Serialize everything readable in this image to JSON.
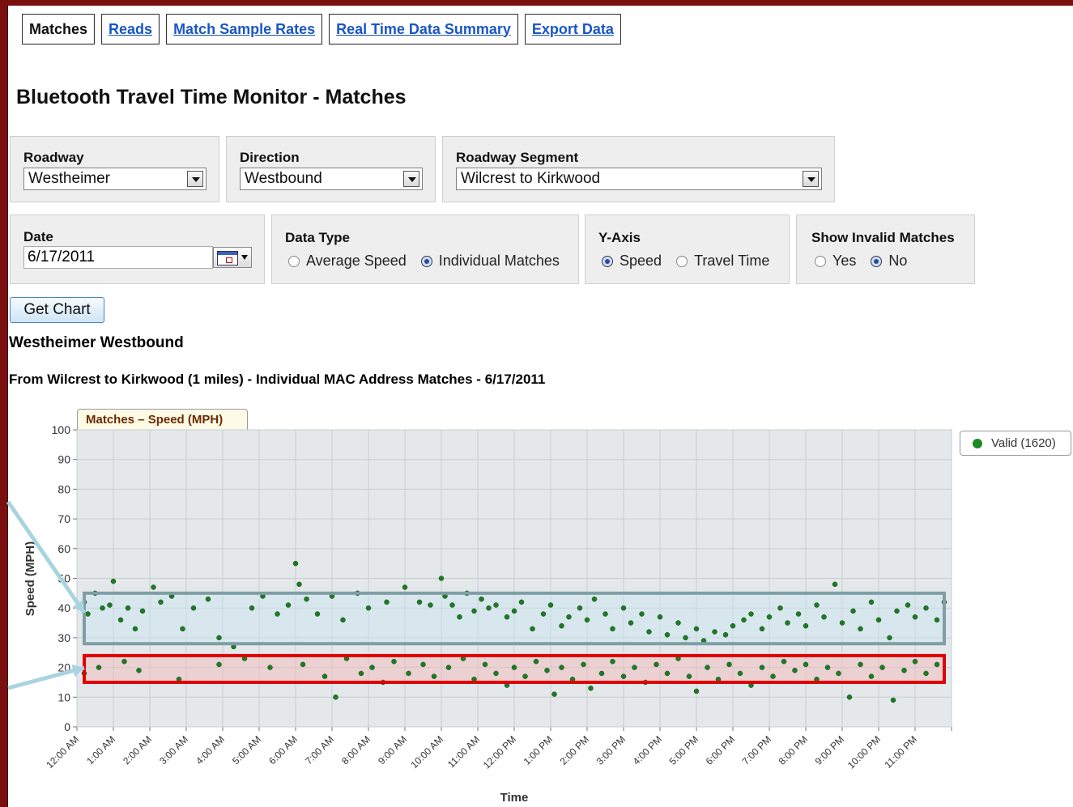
{
  "nav": {
    "tabs": [
      {
        "label": "Matches",
        "active": true
      },
      {
        "label": "Reads",
        "active": false
      },
      {
        "label": "Match Sample Rates",
        "active": false
      },
      {
        "label": "Real Time Data Summary",
        "active": false
      },
      {
        "label": "Export Data",
        "active": false
      }
    ]
  },
  "page": {
    "title": "Bluetooth Travel Time Monitor - Matches"
  },
  "filters": {
    "roadway": {
      "label": "Roadway",
      "value": "Westheimer"
    },
    "direction": {
      "label": "Direction",
      "value": "Westbound"
    },
    "segment": {
      "label": "Roadway Segment",
      "value": "Wilcrest to Kirkwood"
    },
    "date": {
      "label": "Date",
      "value": "6/17/2011"
    },
    "data_type": {
      "label": "Data Type",
      "options": [
        "Average Speed",
        "Individual Matches"
      ],
      "selected": "Individual Matches"
    },
    "y_axis": {
      "label": "Y-Axis",
      "options": [
        "Speed",
        "Travel Time"
      ],
      "selected": "Speed"
    },
    "show_invalid": {
      "label": "Show Invalid Matches",
      "options": [
        "Yes",
        "No"
      ],
      "selected": "No"
    }
  },
  "actions": {
    "get_chart": "Get Chart"
  },
  "report": {
    "heading": "Westheimer Westbound",
    "subheading": "From Wilcrest to Kirkwood (1 miles) - Individual MAC Address Matches - 6/17/2011"
  },
  "chart_data": {
    "type": "scatter",
    "tab_label": "Matches – Speed (MPH)",
    "xlabel": "Time",
    "ylabel": "Speed (MPH)",
    "ylim": [
      0,
      100
    ],
    "y_ticks": [
      0,
      10,
      20,
      30,
      40,
      50,
      60,
      70,
      80,
      90,
      100
    ],
    "x_ticks": [
      "12:00 AM",
      "1:00 AM",
      "2:00 AM",
      "3:00 AM",
      "4:00 AM",
      "5:00 AM",
      "6:00 AM",
      "7:00 AM",
      "8:00 AM",
      "9:00 AM",
      "10:00 AM",
      "11:00 AM",
      "12:00 PM",
      "1:00 PM",
      "2:00 PM",
      "3:00 PM",
      "4:00 PM",
      "5:00 PM",
      "6:00 PM",
      "7:00 PM",
      "8:00 PM",
      "9:00 PM",
      "10:00 PM",
      "11:00 PM"
    ],
    "grid": true,
    "legend": "right",
    "series": [
      {
        "name": "Valid (1620)",
        "color": "#1e7a25",
        "point_count": 1620,
        "x_unit": "hours",
        "points": [
          [
            0.2,
            42
          ],
          [
            0.3,
            38
          ],
          [
            0.5,
            45
          ],
          [
            0.7,
            40
          ],
          [
            0.9,
            41
          ],
          [
            1.0,
            49
          ],
          [
            1.2,
            36
          ],
          [
            1.4,
            40
          ],
          [
            1.6,
            33
          ],
          [
            1.8,
            39
          ],
          [
            2.1,
            47
          ],
          [
            2.3,
            42
          ],
          [
            2.6,
            44
          ],
          [
            2.9,
            33
          ],
          [
            3.2,
            40
          ],
          [
            3.6,
            43
          ],
          [
            3.9,
            30
          ],
          [
            4.3,
            27
          ],
          [
            4.8,
            40
          ],
          [
            5.1,
            44
          ],
          [
            5.5,
            38
          ],
          [
            5.8,
            41
          ],
          [
            6.0,
            55
          ],
          [
            6.1,
            48
          ],
          [
            6.3,
            43
          ],
          [
            6.6,
            38
          ],
          [
            7.0,
            44
          ],
          [
            7.3,
            36
          ],
          [
            7.7,
            45
          ],
          [
            8.0,
            40
          ],
          [
            8.5,
            42
          ],
          [
            9.0,
            47
          ],
          [
            9.4,
            42
          ],
          [
            9.7,
            41
          ],
          [
            10.0,
            50
          ],
          [
            10.1,
            44
          ],
          [
            10.3,
            41
          ],
          [
            10.5,
            37
          ],
          [
            10.7,
            45
          ],
          [
            10.9,
            39
          ],
          [
            11.1,
            43
          ],
          [
            11.3,
            40
          ],
          [
            11.5,
            41
          ],
          [
            11.8,
            37
          ],
          [
            12.0,
            39
          ],
          [
            12.2,
            42
          ],
          [
            12.5,
            33
          ],
          [
            12.8,
            38
          ],
          [
            13.0,
            41
          ],
          [
            13.3,
            34
          ],
          [
            13.5,
            37
          ],
          [
            13.8,
            40
          ],
          [
            14.0,
            36
          ],
          [
            14.2,
            43
          ],
          [
            14.5,
            38
          ],
          [
            14.7,
            33
          ],
          [
            15.0,
            40
          ],
          [
            15.2,
            35
          ],
          [
            15.5,
            38
          ],
          [
            15.7,
            32
          ],
          [
            16.0,
            37
          ],
          [
            16.2,
            31
          ],
          [
            16.5,
            35
          ],
          [
            16.7,
            30
          ],
          [
            17.0,
            33
          ],
          [
            17.2,
            29
          ],
          [
            17.5,
            32
          ],
          [
            17.8,
            31
          ],
          [
            18.0,
            34
          ],
          [
            18.3,
            36
          ],
          [
            18.5,
            38
          ],
          [
            18.8,
            33
          ],
          [
            19.0,
            37
          ],
          [
            19.3,
            40
          ],
          [
            19.5,
            35
          ],
          [
            19.8,
            38
          ],
          [
            20.0,
            34
          ],
          [
            20.3,
            41
          ],
          [
            20.5,
            37
          ],
          [
            20.8,
            48
          ],
          [
            21.0,
            35
          ],
          [
            21.3,
            39
          ],
          [
            21.5,
            33
          ],
          [
            21.8,
            42
          ],
          [
            22.0,
            36
          ],
          [
            22.3,
            30
          ],
          [
            22.5,
            39
          ],
          [
            22.8,
            41
          ],
          [
            23.0,
            37
          ],
          [
            23.3,
            40
          ],
          [
            23.6,
            36
          ],
          [
            23.8,
            42
          ],
          [
            0.2,
            18
          ],
          [
            0.6,
            20
          ],
          [
            1.3,
            22
          ],
          [
            1.7,
            19
          ],
          [
            2.8,
            16
          ],
          [
            3.9,
            21
          ],
          [
            4.6,
            23
          ],
          [
            5.3,
            20
          ],
          [
            6.2,
            21
          ],
          [
            6.8,
            17
          ],
          [
            7.1,
            10
          ],
          [
            7.4,
            23
          ],
          [
            7.8,
            18
          ],
          [
            8.1,
            20
          ],
          [
            8.4,
            15
          ],
          [
            8.7,
            22
          ],
          [
            9.1,
            18
          ],
          [
            9.5,
            21
          ],
          [
            9.8,
            17
          ],
          [
            10.2,
            20
          ],
          [
            10.6,
            23
          ],
          [
            10.9,
            16
          ],
          [
            11.2,
            21
          ],
          [
            11.5,
            18
          ],
          [
            11.8,
            14
          ],
          [
            12.0,
            20
          ],
          [
            12.3,
            17
          ],
          [
            12.6,
            22
          ],
          [
            12.9,
            19
          ],
          [
            13.1,
            11
          ],
          [
            13.3,
            20
          ],
          [
            13.6,
            16
          ],
          [
            13.9,
            21
          ],
          [
            14.1,
            13
          ],
          [
            14.4,
            18
          ],
          [
            14.7,
            22
          ],
          [
            15.0,
            17
          ],
          [
            15.3,
            20
          ],
          [
            15.6,
            15
          ],
          [
            15.9,
            21
          ],
          [
            16.2,
            18
          ],
          [
            16.5,
            23
          ],
          [
            16.8,
            17
          ],
          [
            17.0,
            12
          ],
          [
            17.3,
            20
          ],
          [
            17.6,
            16
          ],
          [
            17.9,
            21
          ],
          [
            18.2,
            18
          ],
          [
            18.5,
            14
          ],
          [
            18.8,
            20
          ],
          [
            19.1,
            17
          ],
          [
            19.4,
            22
          ],
          [
            19.7,
            19
          ],
          [
            20.0,
            21
          ],
          [
            20.3,
            16
          ],
          [
            20.6,
            20
          ],
          [
            20.9,
            18
          ],
          [
            21.2,
            10
          ],
          [
            21.5,
            21
          ],
          [
            21.8,
            17
          ],
          [
            22.1,
            20
          ],
          [
            22.4,
            9
          ],
          [
            22.7,
            19
          ],
          [
            23.0,
            22
          ],
          [
            23.3,
            18
          ],
          [
            23.6,
            21
          ]
        ]
      }
    ],
    "annotations": [
      {
        "type": "highlight-box",
        "color": "#7f9ea6",
        "y_range": [
          28,
          45
        ],
        "x_range": [
          0.2,
          23.8
        ]
      },
      {
        "type": "highlight-box",
        "color": "#e00000",
        "y_range": [
          15,
          24
        ],
        "x_range": [
          0.2,
          23.8
        ]
      }
    ]
  }
}
